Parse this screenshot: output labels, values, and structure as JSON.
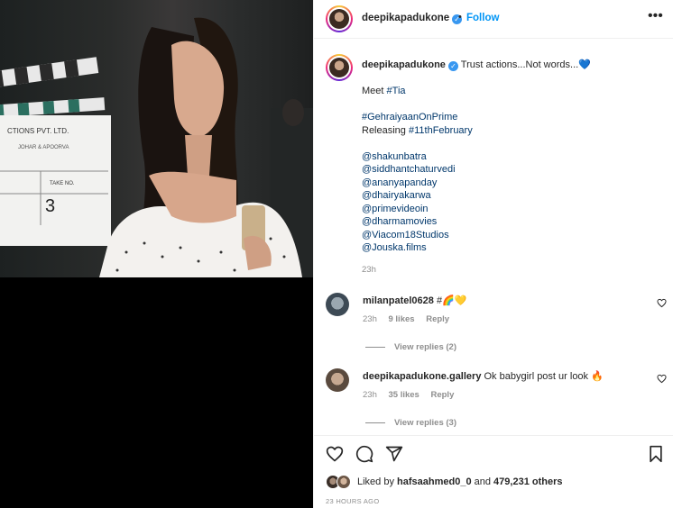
{
  "post": {
    "author": "deepikapadukone",
    "follow_label": "Follow",
    "dot": "•",
    "more_label": "•••"
  },
  "caption": {
    "author": "deepikapadukone",
    "first_line": "Trust actions...Not words...",
    "heart_emoji": "💙",
    "meet_prefix": "Meet ",
    "meet_tag": "#Tia",
    "tag1": "#GehraiyaanOnPrime",
    "releasing_prefix": "Releasing ",
    "releasing_tag": "#11thFebruary",
    "mentions": [
      "@shakunbatra",
      "@siddhantchaturvedi",
      "@ananyapanday",
      "@dhairyakarwa",
      "@primevideoin",
      "@dharmamovies",
      "@Viacom18Studios",
      "@Jouska.films"
    ],
    "time": "23h"
  },
  "comments": [
    {
      "user": "milanpatel0628",
      "text": "#🌈💛",
      "time": "23h",
      "likes": "9 likes",
      "reply": "Reply",
      "view_replies": "View replies (2)"
    },
    {
      "user": "deepikapadukone.gallery",
      "text": "Ok babygirl post ur look 🔥",
      "time": "23h",
      "likes": "35 likes",
      "reply": "Reply",
      "view_replies": "View replies (3)"
    }
  ],
  "likes": {
    "prefix": "Liked by ",
    "user": "hafsaahmed0_0",
    "middle": " and ",
    "count": "479,231 others"
  },
  "posted_ago": "23 HOURS AGO",
  "colors": {
    "link": "#00376b",
    "follow": "#0095f6",
    "muted": "#8e8e8e",
    "verified": "#3897f0"
  }
}
